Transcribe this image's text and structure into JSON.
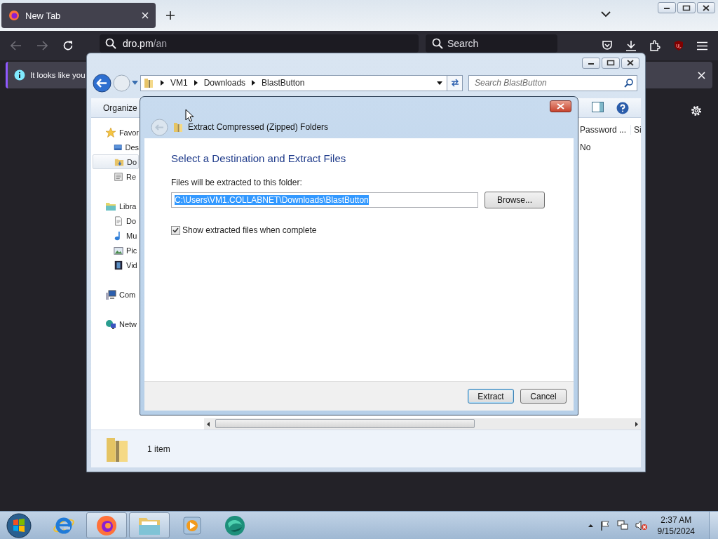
{
  "browser": {
    "tabs": [
      {
        "title": "New Tab",
        "selected": true
      }
    ],
    "address": {
      "host": "dro.pm",
      "path": "/an"
    },
    "search": {
      "placeholder": "Search"
    },
    "notification": {
      "text": "It looks like you"
    }
  },
  "explorer": {
    "breadcrumb": [
      "VM1",
      "Downloads",
      "BlastButton"
    ],
    "search": {
      "placeholder": "Search BlastButton"
    },
    "toolbar": [
      "Organize"
    ],
    "nav": [
      {
        "label": "Favor",
        "kind": "favorites",
        "selected": false,
        "children": [
          {
            "label": "Des",
            "kind": "desktop",
            "selected": false
          },
          {
            "label": "Do",
            "kind": "downloads",
            "selected": true
          },
          {
            "label": "Re",
            "kind": "recent",
            "selected": false
          }
        ]
      },
      {
        "label": "Libra",
        "kind": "libraries",
        "selected": false,
        "children": [
          {
            "label": "Do",
            "kind": "documents",
            "selected": false
          },
          {
            "label": "Mu",
            "kind": "music",
            "selected": false
          },
          {
            "label": "Pic",
            "kind": "pictures",
            "selected": false
          },
          {
            "label": "Vid",
            "kind": "videos",
            "selected": false
          }
        ]
      },
      {
        "label": "Com",
        "kind": "computer",
        "selected": false
      },
      {
        "label": "Netw",
        "kind": "network",
        "selected": false
      }
    ],
    "columns": [
      "Password ...",
      "Si"
    ],
    "rows": [
      [
        "No"
      ]
    ],
    "status": "1 item"
  },
  "dialog": {
    "title": "Extract Compressed (Zipped) Folders",
    "heading": "Select a Destination and Extract Files",
    "label": "Files will be extracted to this folder:",
    "path": {
      "value": "C:\\Users\\VM1.COLLABNET\\Downloads\\BlastButton",
      "selected": true
    },
    "browse": "Browse...",
    "show_files": {
      "label": "Show extracted files when complete",
      "checked": true
    },
    "buttons": [
      {
        "label": "Extract",
        "default": true
      },
      {
        "label": "Cancel",
        "default": false
      }
    ]
  },
  "taskbar": {
    "apps": [
      {
        "kind": "ie",
        "active": false
      },
      {
        "kind": "firefox",
        "active": true
      },
      {
        "kind": "explorer",
        "active": true
      },
      {
        "kind": "media",
        "active": false
      },
      {
        "kind": "globe",
        "active": false
      }
    ],
    "clock": {
      "time": "2:37 AM",
      "date": "9/15/2024"
    }
  }
}
